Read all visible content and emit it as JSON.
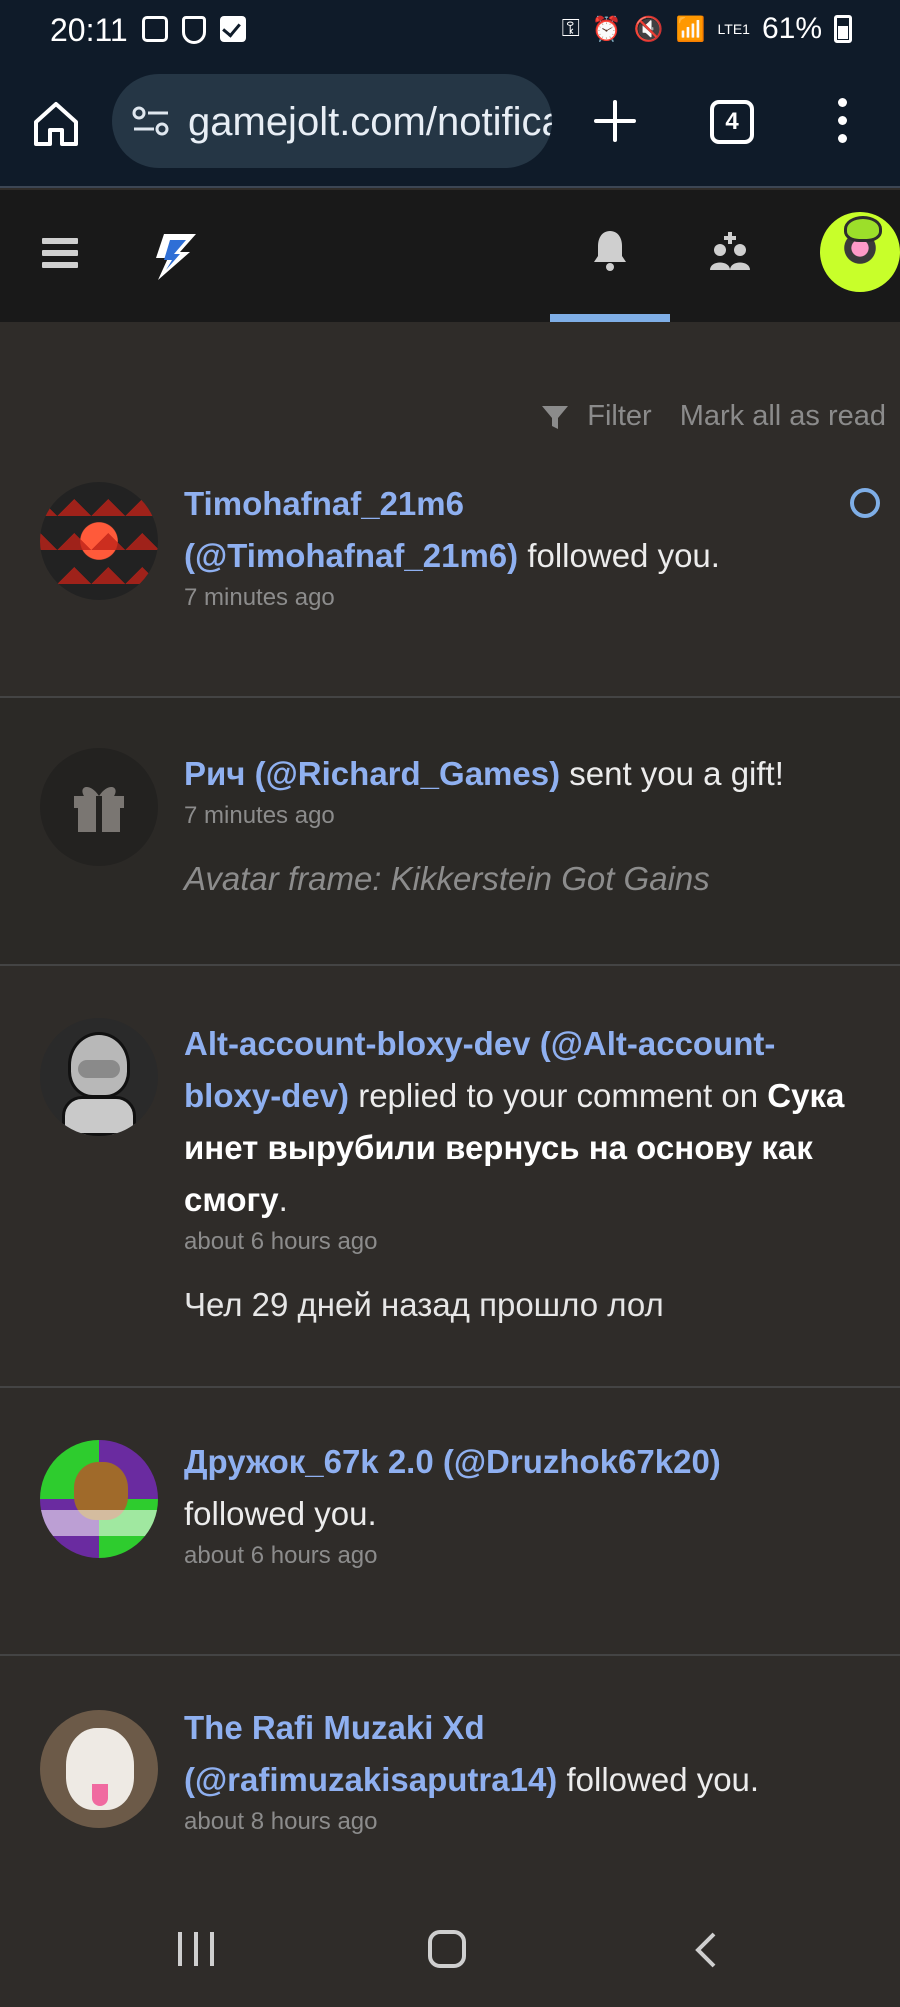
{
  "status_bar": {
    "time": "20:11",
    "battery": "61%",
    "network": "LTE1"
  },
  "browser": {
    "url": "gamejolt.com/notifications",
    "tab_count": "4"
  },
  "filter_bar": {
    "filter_label": "Filter",
    "mark_all_label": "Mark all as read"
  },
  "notifications": [
    {
      "name": "Timohafnaf_21m6",
      "handle": "(@Timohafnaf_21m6)",
      "action": " followed you.",
      "time": "7 minutes ago",
      "unread": true
    },
    {
      "name": "Рич",
      "handle": "(@Richard_Games)",
      "action": " sent you a gift!",
      "time": "7 minutes ago",
      "detail": "Avatar frame: Kikkerstein Got Gains"
    },
    {
      "name": "Alt-account-bloxy-dev",
      "handle": "(@Alt-account-bloxy-dev)",
      "action": " replied to your comment on ",
      "target": "Сука инет вырубили вернусь на основу как смогу",
      "target_suffix": ".",
      "time": "about 6 hours ago",
      "detail": "Чел 29 дней назад прошло лол"
    },
    {
      "name": "Дружок_67k 2.0",
      "handle": "(@Druzhok67k20)",
      "action": "followed you.",
      "time": "about 6 hours ago"
    },
    {
      "name": "The Rafi Muzaki Xd",
      "handle": "(@rafimuzakisaputra14)",
      "action": " followed you.",
      "time": "about 8 hours ago"
    }
  ],
  "colors": {
    "link": "#8fb0f0",
    "accent": "#7faee6",
    "background": "#2f2c29",
    "topbar": "#191919",
    "browser": "#0f1b29"
  }
}
